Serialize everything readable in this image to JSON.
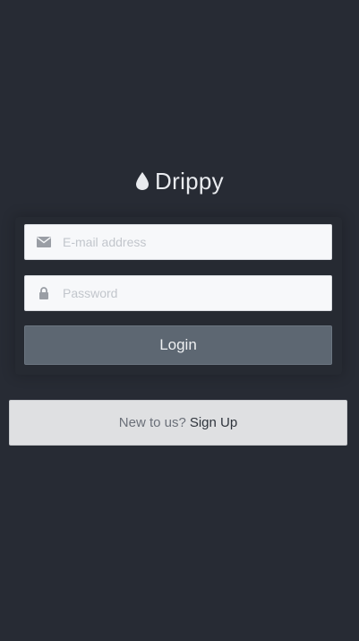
{
  "brand": {
    "name": "Drippy",
    "icon": "droplet-icon"
  },
  "login_form": {
    "email": {
      "placeholder": "E-mail address",
      "value": "",
      "icon": "envelope-icon"
    },
    "password": {
      "placeholder": "Password",
      "value": "",
      "icon": "lock-icon"
    },
    "submit_label": "Login"
  },
  "signup": {
    "prompt": "New to us?",
    "link_label": "Sign Up"
  },
  "colors": {
    "background": "#272b34",
    "login_button": "#5d6772",
    "signup_bar": "#dfe0e2"
  }
}
